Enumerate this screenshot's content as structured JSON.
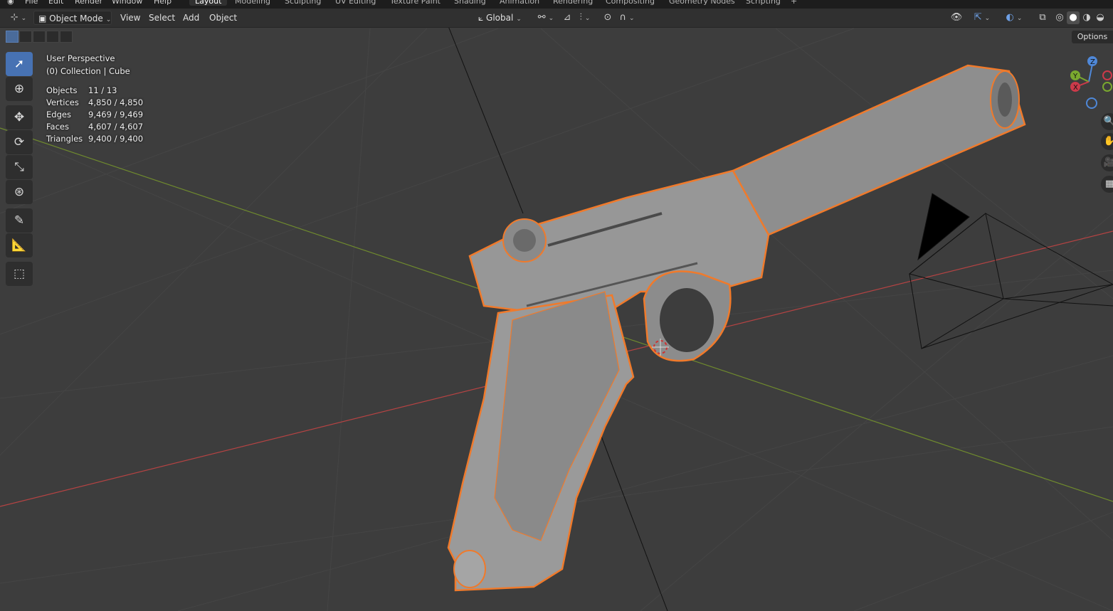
{
  "menubar": {
    "items": [
      "File",
      "Edit",
      "Render",
      "Window",
      "Help"
    ],
    "workspaces": [
      "Layout",
      "Modeling",
      "Sculpting",
      "UV Editing",
      "Texture Paint",
      "Shading",
      "Animation",
      "Rendering",
      "Compositing",
      "Geometry Nodes",
      "Scripting"
    ],
    "active_workspace": "Layout",
    "add_tab": "+"
  },
  "header": {
    "mode": "Object Mode",
    "menus": [
      "View",
      "Select",
      "Add",
      "Object"
    ],
    "orientation": "Global"
  },
  "overlay": {
    "perspective": "User Perspective",
    "collection": "(0) Collection | Cube",
    "stats": [
      {
        "label": "Objects",
        "value": "11 / 13"
      },
      {
        "label": "Vertices",
        "value": "4,850 / 4,850"
      },
      {
        "label": "Edges",
        "value": "9,469 / 9,469"
      },
      {
        "label": "Faces",
        "value": "4,607 / 4,607"
      },
      {
        "label": "Triangles",
        "value": "9,400 / 9,400"
      }
    ]
  },
  "options_label": "Options",
  "gizmo": {
    "z": "Z",
    "y": "Y",
    "x": "X"
  },
  "colors": {
    "accent": "#4772b3",
    "selection_outline": "#f07a2b",
    "x_axis": "#b54343",
    "y_axis": "#6f8a2e",
    "background": "#3d3d3d"
  }
}
